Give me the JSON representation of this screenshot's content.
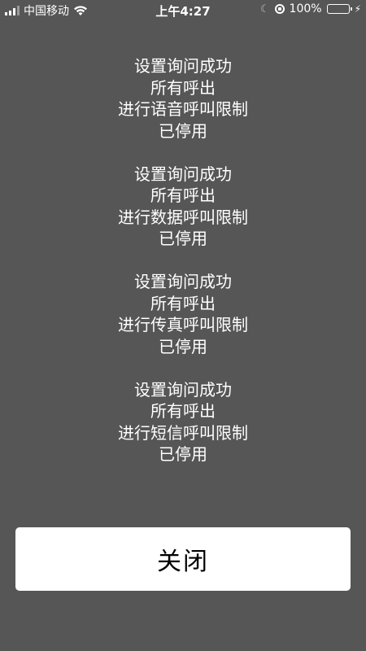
{
  "status_bar": {
    "carrier": "中国移动",
    "time": "上午4:27",
    "battery_percent_label": "100%",
    "battery_level": 1.0,
    "battery_color": "#4cd964",
    "icons": [
      "signal-icon",
      "wifi-icon",
      "moon-icon",
      "rotation-lock-icon",
      "battery-icon",
      "charging-bolt-icon"
    ]
  },
  "messages": [
    {
      "line1": "设置询问成功",
      "line2": "所有呼出",
      "line3": "进行语音呼叫限制",
      "line4": "已停用"
    },
    {
      "line1": "设置询问成功",
      "line2": "所有呼出",
      "line3": "进行数据呼叫限制",
      "line4": "已停用"
    },
    {
      "line1": "设置询问成功",
      "line2": "所有呼出",
      "line3": "进行传真呼叫限制",
      "line4": "已停用"
    },
    {
      "line1": "设置询问成功",
      "line2": "所有呼出",
      "line3": "进行短信呼叫限制",
      "line4": "已停用"
    }
  ],
  "close_button": {
    "label": "关闭"
  },
  "colors": {
    "background": "#565656",
    "text": "#ffffff",
    "button_bg": "#ffffff"
  }
}
